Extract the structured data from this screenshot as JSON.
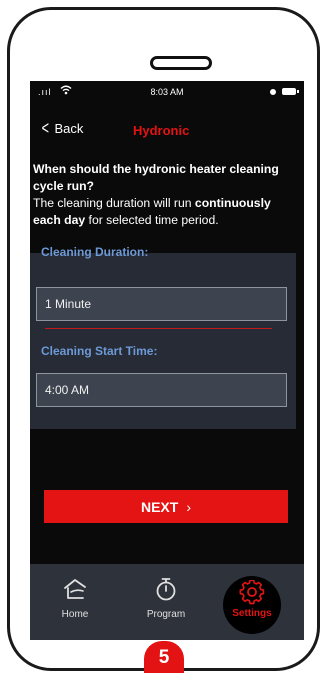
{
  "status_bar": {
    "time": "8:03 AM",
    "signal": ".ııl"
  },
  "nav": {
    "back_label": "Back",
    "title": "Hydronic"
  },
  "question": {
    "bold_line": "When should the hydronic heater cleaning cycle run?",
    "text_before": "The cleaning duration will run ",
    "bold_inline": "continuously each day",
    "text_after": " for selected time period."
  },
  "duration": {
    "label": "Cleaning Duration:",
    "value": "1 Minute"
  },
  "start_time": {
    "label": "Cleaning Start Time:",
    "value": "4:00 AM"
  },
  "next_button": {
    "label": "NEXT",
    "arrow": "›"
  },
  "tabs": [
    {
      "label": "Home",
      "icon": "home-icon",
      "active": false
    },
    {
      "label": "Program",
      "icon": "timer-icon",
      "active": false
    },
    {
      "label": "Settings",
      "icon": "gear-icon",
      "active": true
    }
  ],
  "step": "5",
  "colors": {
    "accent": "#e31313",
    "label_blue": "#6d9ad6",
    "panel": "#262b36",
    "tabbar": "#2e323a"
  }
}
